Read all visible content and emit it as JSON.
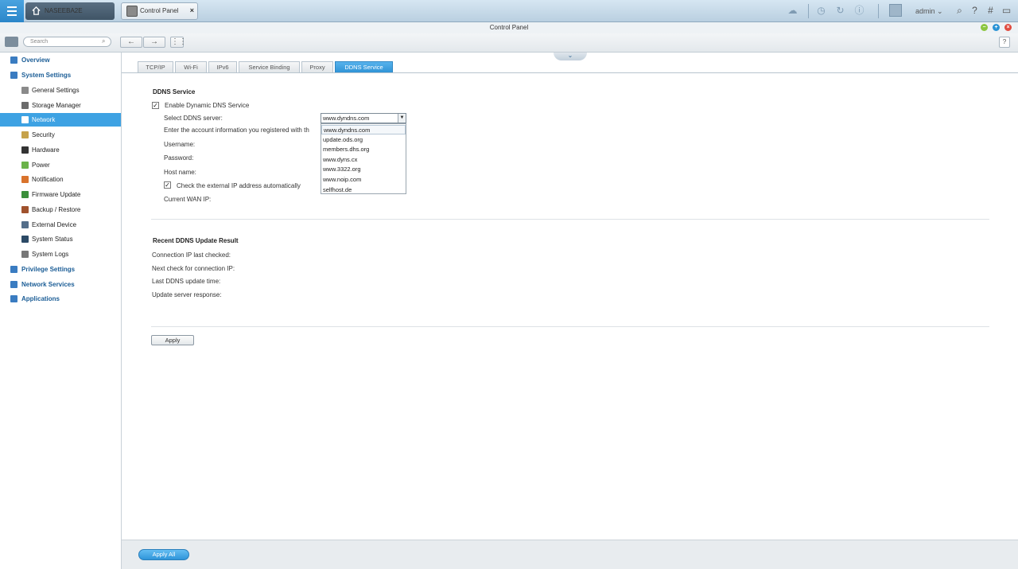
{
  "topbar": {
    "home_label": "NASEEBA2E",
    "app_tab_label": "Control Panel",
    "close_glyph": "×",
    "user": "admin",
    "user_caret": "⌄"
  },
  "window": {
    "title": "Control Panel"
  },
  "toolbar": {
    "search_placeholder": "Search",
    "back": "←",
    "forward": "→",
    "help": "?"
  },
  "sidebar": {
    "items": [
      {
        "label": "Overview",
        "level": "top",
        "icon": "overview-icon",
        "color": "#3a7cc1"
      },
      {
        "label": "System Settings",
        "level": "top",
        "icon": "gear-icon",
        "color": "#3a7cc1"
      },
      {
        "label": "General Settings",
        "level": "sub",
        "icon": "settings-icon",
        "color": "#8a8a8a"
      },
      {
        "label": "Storage Manager",
        "level": "sub",
        "icon": "storage-icon",
        "color": "#6b6b6b"
      },
      {
        "label": "Network",
        "level": "sub",
        "icon": "network-icon",
        "color": "#2a8ad0",
        "active": true
      },
      {
        "label": "Security",
        "level": "sub",
        "icon": "lock-icon",
        "color": "#c6a24a"
      },
      {
        "label": "Hardware",
        "level": "sub",
        "icon": "hardware-icon",
        "color": "#333333"
      },
      {
        "label": "Power",
        "level": "sub",
        "icon": "power-icon",
        "color": "#6bb34a"
      },
      {
        "label": "Notification",
        "level": "sub",
        "icon": "notification-icon",
        "color": "#d9732c"
      },
      {
        "label": "Firmware Update",
        "level": "sub",
        "icon": "firmware-icon",
        "color": "#3b8f3b"
      },
      {
        "label": "Backup / Restore",
        "level": "sub",
        "icon": "backup-icon",
        "color": "#a0522d"
      },
      {
        "label": "External Device",
        "level": "sub",
        "icon": "external-device-icon",
        "color": "#546e8a"
      },
      {
        "label": "System Status",
        "level": "sub",
        "icon": "monitor-icon",
        "color": "#2c4a66"
      },
      {
        "label": "System Logs",
        "level": "sub",
        "icon": "logs-icon",
        "color": "#777777"
      },
      {
        "label": "Privilege Settings",
        "level": "top",
        "icon": "user-icon",
        "color": "#3a7cc1"
      },
      {
        "label": "Network Services",
        "level": "top",
        "icon": "globe-icon",
        "color": "#3a7cc1"
      },
      {
        "label": "Applications",
        "level": "top",
        "icon": "applications-icon",
        "color": "#3a7cc1"
      }
    ]
  },
  "tabs": [
    "TCP/IP",
    "Wi-Fi",
    "IPv6",
    "Service Binding",
    "Proxy",
    "DDNS Service"
  ],
  "ddns": {
    "title": "DDNS Service",
    "enable_label": "Enable Dynamic DNS Service",
    "enable_checked": true,
    "select_label": "Select DDNS server:",
    "select_value": "www.dyndns.com",
    "options": [
      "www.dyndns.com",
      "update.ods.org",
      "members.dhs.org",
      "www.dyns.cx",
      "www.3322.org",
      "www.noip.com",
      "selfhost.de"
    ],
    "account_info": "Enter the account information you registered with th",
    "username_label": "Username:",
    "password_label": "Password:",
    "hostname_label": "Host name:",
    "check_ip_label": "Check the external IP address automatically",
    "check_ip_checked": true,
    "wan_ip_label": "Current WAN IP:"
  },
  "recent": {
    "title": "Recent DDNS Update Result",
    "labels": [
      "Connection IP last checked:",
      "Next check for connection IP:",
      "Last DDNS update time:",
      "Update server response:"
    ]
  },
  "buttons": {
    "apply": "Apply",
    "apply_all": "Apply All"
  },
  "colors": {
    "accent": "#3ea2e3",
    "nav_text": "#1b5d96"
  }
}
